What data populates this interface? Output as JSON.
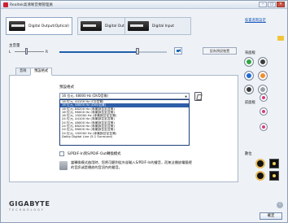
{
  "window": {
    "title": "Realtek高清晰音頻管理員",
    "minimize": "–",
    "maximize": "□",
    "close": "✕"
  },
  "device_tabs": [
    {
      "label": "Digital Output(Optical)",
      "active": true
    },
    {
      "label": "Digital Output",
      "active": false
    },
    {
      "label": "Digital Input",
      "active": false
    }
  ],
  "advanced_link": "裝置進階設定",
  "volume": {
    "label": "主音量",
    "left": "L",
    "right": "R",
    "level": 0.73,
    "default_device_button": "設為預設裝置"
  },
  "inner_tabs": [
    {
      "label": "音效",
      "active": false
    },
    {
      "label": "預設格式",
      "active": true
    }
  ],
  "format": {
    "label": "預設格式",
    "selected": "16 位元, 48000 Hz (DVD音質)",
    "options": [
      "16 位元, 44100 Hz (CD音質)",
      "16 位元, 48000 Hz (DVD音質)",
      "16 位元, 88200 Hz (專業錄音室音質)",
      "16 位元, 96000 Hz (專業錄音室音質)",
      "16 位元, 192000 Hz (專業錄音室音質)",
      "24 位元, 44100 Hz (專業錄音室音質)",
      "24 位元, 48000 Hz (專業錄音室音質)",
      "24 位元, 88200 Hz (專業錄音室音質)",
      "24 位元, 96000 Hz (專業錄音室音質)",
      "24 位元, 192000 Hz (專業錄音室音質)",
      "Dolby Digital Live (5.1 Surround)"
    ],
    "highlighted_index": 1
  },
  "spdif": {
    "label": "S/PDIF-In到S/PDIF-Out轉換模式",
    "note": "當轉換模式啟用時，您將可聽到從外部輸入S/PDIF-In的聲音，而無法播放電腦裡的音訊或是播放的音訊內的聲音。"
  },
  "right_panel": {
    "rear_label": "背面板",
    "front_label": "前面板",
    "digital_label": "數位",
    "jack_colors": [
      "#32a542",
      "#3b3b3b",
      "#1e6ad8",
      "#f08e2f",
      "#3b3b3b",
      "#9aa0a8",
      "#d33d7e",
      "#d33d7e",
      "#d33d7e"
    ]
  },
  "brand": {
    "logo": "GIGABYTE",
    "tagline": "TECHNOLOGY"
  },
  "info_icon": "i",
  "ok_button": "確定"
}
